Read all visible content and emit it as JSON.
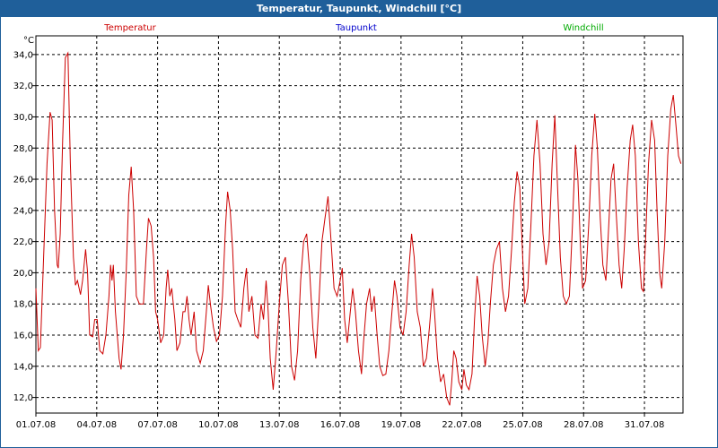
{
  "window": {
    "title": "Temperatur, Taupunkt, Windchill [°C]"
  },
  "chart_data": {
    "type": "line",
    "title": "Temperatur, Taupunkt, Windchill [°C]",
    "ylabel": "°C",
    "xlabel": "",
    "x_range_days": [
      1,
      32.9
    ],
    "ylim": [
      11,
      35.2
    ],
    "yticks": [
      12.0,
      14.0,
      16.0,
      18.0,
      20.0,
      22.0,
      24.0,
      26.0,
      28.0,
      30.0,
      32.0,
      34.0
    ],
    "ytick_labels": [
      "12,0",
      "14,0",
      "16,0",
      "18,0",
      "20,0",
      "22,0",
      "24,0",
      "26,0",
      "28,0",
      "30,0",
      "32,0",
      "34,0"
    ],
    "xticks": [
      1,
      4,
      7,
      10,
      13,
      16,
      19,
      22,
      25,
      28,
      31
    ],
    "xtick_labels": [
      "01.07.08",
      "04.07.08",
      "07.07.08",
      "10.07.08",
      "13.07.08",
      "16.07.08",
      "19.07.08",
      "22.07.08",
      "25.07.08",
      "28.07.08",
      "31.07.08"
    ],
    "grid": true,
    "legend": [
      {
        "name": "Temperatur",
        "color": "#cc0000"
      },
      {
        "name": "Taupunkt",
        "color": "#0000cc"
      },
      {
        "name": "Windchill",
        "color": "#00aa00"
      }
    ],
    "series": [
      {
        "name": "Temperatur",
        "color": "#cc0000",
        "points": [
          [
            1.0,
            19.0
          ],
          [
            1.12,
            15.0
          ],
          [
            1.22,
            15.2
          ],
          [
            1.38,
            21.0
          ],
          [
            1.55,
            27.0
          ],
          [
            1.7,
            30.3
          ],
          [
            1.8,
            29.8
          ],
          [
            1.92,
            24.0
          ],
          [
            2.05,
            20.5
          ],
          [
            2.1,
            20.3
          ],
          [
            2.2,
            22.5
          ],
          [
            2.32,
            28.5
          ],
          [
            2.45,
            33.8
          ],
          [
            2.58,
            34.1
          ],
          [
            2.7,
            27.0
          ],
          [
            2.85,
            21.0
          ],
          [
            2.95,
            19.2
          ],
          [
            3.05,
            19.5
          ],
          [
            3.2,
            18.6
          ],
          [
            3.3,
            19.5
          ],
          [
            3.45,
            21.5
          ],
          [
            3.55,
            20.0
          ],
          [
            3.65,
            16.0
          ],
          [
            3.8,
            15.9
          ],
          [
            3.9,
            17.0
          ],
          [
            4.02,
            17.0
          ],
          [
            4.15,
            15.0
          ],
          [
            4.3,
            14.8
          ],
          [
            4.45,
            16.0
          ],
          [
            4.6,
            18.5
          ],
          [
            4.68,
            20.5
          ],
          [
            4.75,
            19.5
          ],
          [
            4.82,
            20.5
          ],
          [
            4.92,
            17.5
          ],
          [
            5.1,
            14.5
          ],
          [
            5.2,
            13.8
          ],
          [
            5.32,
            16.0
          ],
          [
            5.45,
            20.0
          ],
          [
            5.58,
            25.0
          ],
          [
            5.7,
            26.8
          ],
          [
            5.82,
            24.0
          ],
          [
            5.95,
            18.5
          ],
          [
            6.1,
            18.0
          ],
          [
            6.3,
            18.0
          ],
          [
            6.45,
            21.5
          ],
          [
            6.55,
            23.5
          ],
          [
            6.68,
            23.0
          ],
          [
            6.8,
            21.0
          ],
          [
            6.9,
            17.5
          ],
          [
            7.0,
            17.0
          ],
          [
            7.15,
            15.5
          ],
          [
            7.3,
            16.0
          ],
          [
            7.42,
            19.0
          ],
          [
            7.5,
            20.2
          ],
          [
            7.6,
            18.5
          ],
          [
            7.7,
            19.0
          ],
          [
            7.85,
            17.0
          ],
          [
            7.95,
            15.0
          ],
          [
            8.1,
            15.5
          ],
          [
            8.25,
            17.5
          ],
          [
            8.35,
            17.5
          ],
          [
            8.45,
            18.5
          ],
          [
            8.55,
            17.0
          ],
          [
            8.65,
            16.0
          ],
          [
            8.8,
            17.5
          ],
          [
            8.92,
            15.0
          ],
          [
            9.1,
            14.2
          ],
          [
            9.25,
            15.0
          ],
          [
            9.4,
            17.5
          ],
          [
            9.5,
            19.2
          ],
          [
            9.6,
            18.0
          ],
          [
            9.75,
            16.5
          ],
          [
            9.9,
            15.6
          ],
          [
            10.05,
            16.0
          ],
          [
            10.2,
            18.5
          ],
          [
            10.35,
            23.0
          ],
          [
            10.45,
            25.2
          ],
          [
            10.58,
            24.0
          ],
          [
            10.7,
            21.5
          ],
          [
            10.82,
            17.5
          ],
          [
            10.95,
            17.0
          ],
          [
            11.1,
            16.5
          ],
          [
            11.25,
            19.0
          ],
          [
            11.38,
            20.3
          ],
          [
            11.5,
            17.5
          ],
          [
            11.65,
            18.5
          ],
          [
            11.8,
            16.0
          ],
          [
            11.95,
            15.8
          ],
          [
            12.1,
            18.0
          ],
          [
            12.22,
            17.0
          ],
          [
            12.35,
            19.5
          ],
          [
            12.45,
            17.5
          ],
          [
            12.55,
            14.5
          ],
          [
            12.7,
            12.5
          ],
          [
            12.85,
            15.0
          ],
          [
            13.0,
            18.0
          ],
          [
            13.15,
            20.5
          ],
          [
            13.3,
            21.0
          ],
          [
            13.45,
            18.0
          ],
          [
            13.6,
            14.0
          ],
          [
            13.75,
            13.1
          ],
          [
            13.9,
            15.0
          ],
          [
            14.05,
            19.5
          ],
          [
            14.2,
            22.0
          ],
          [
            14.35,
            22.5
          ],
          [
            14.5,
            20.0
          ],
          [
            14.65,
            16.5
          ],
          [
            14.8,
            14.5
          ],
          [
            14.95,
            18.0
          ],
          [
            15.1,
            22.0
          ],
          [
            15.25,
            23.5
          ],
          [
            15.4,
            24.9
          ],
          [
            15.55,
            22.0
          ],
          [
            15.7,
            19.0
          ],
          [
            15.85,
            18.5
          ],
          [
            16.0,
            19.5
          ],
          [
            16.1,
            20.3
          ],
          [
            16.22,
            17.0
          ],
          [
            16.35,
            15.5
          ],
          [
            16.5,
            17.5
          ],
          [
            16.62,
            19.0
          ],
          [
            16.75,
            17.5
          ],
          [
            16.9,
            15.0
          ],
          [
            17.05,
            13.5
          ],
          [
            17.15,
            15.5
          ],
          [
            17.3,
            18.0
          ],
          [
            17.45,
            19.0
          ],
          [
            17.55,
            17.5
          ],
          [
            17.68,
            18.5
          ],
          [
            17.82,
            16.0
          ],
          [
            17.95,
            14.0
          ],
          [
            18.1,
            13.4
          ],
          [
            18.25,
            13.5
          ],
          [
            18.4,
            15.0
          ],
          [
            18.55,
            17.5
          ],
          [
            18.68,
            19.5
          ],
          [
            18.8,
            18.5
          ],
          [
            18.95,
            16.5
          ],
          [
            19.1,
            16.0
          ],
          [
            19.25,
            17.5
          ],
          [
            19.4,
            20.5
          ],
          [
            19.52,
            22.5
          ],
          [
            19.65,
            21.0
          ],
          [
            19.8,
            17.5
          ],
          [
            19.95,
            16.5
          ],
          [
            20.1,
            14.0
          ],
          [
            20.25,
            14.5
          ],
          [
            20.4,
            16.5
          ],
          [
            20.55,
            19.0
          ],
          [
            20.65,
            17.5
          ],
          [
            20.8,
            14.5
          ],
          [
            20.95,
            13.0
          ],
          [
            21.1,
            13.5
          ],
          [
            21.25,
            12.0
          ],
          [
            21.4,
            11.5
          ],
          [
            21.5,
            13.0
          ],
          [
            21.6,
            15.0
          ],
          [
            21.72,
            14.5
          ],
          [
            21.85,
            13.0
          ],
          [
            22.0,
            12.5
          ],
          [
            22.1,
            13.8
          ],
          [
            22.22,
            12.8
          ],
          [
            22.35,
            12.5
          ],
          [
            22.5,
            13.5
          ],
          [
            22.62,
            17.0
          ],
          [
            22.75,
            19.8
          ],
          [
            22.88,
            18.5
          ],
          [
            23.0,
            16.0
          ],
          [
            23.15,
            14.0
          ],
          [
            23.28,
            15.5
          ],
          [
            23.4,
            18.0
          ],
          [
            23.55,
            20.5
          ],
          [
            23.7,
            21.5
          ],
          [
            23.85,
            22.0
          ],
          [
            24.0,
            19.0
          ],
          [
            24.15,
            17.5
          ],
          [
            24.3,
            18.5
          ],
          [
            24.45,
            21.5
          ],
          [
            24.58,
            24.5
          ],
          [
            24.72,
            26.5
          ],
          [
            24.85,
            25.5
          ],
          [
            25.0,
            21.0
          ],
          [
            25.1,
            18.0
          ],
          [
            25.25,
            19.0
          ],
          [
            25.4,
            23.0
          ],
          [
            25.55,
            27.5
          ],
          [
            25.7,
            29.8
          ],
          [
            25.85,
            27.0
          ],
          [
            26.0,
            22.5
          ],
          [
            26.15,
            20.5
          ],
          [
            26.3,
            22.0
          ],
          [
            26.45,
            27.0
          ],
          [
            26.58,
            30.1
          ],
          [
            26.7,
            26.0
          ],
          [
            26.85,
            21.0
          ],
          [
            27.0,
            18.5
          ],
          [
            27.15,
            18.0
          ],
          [
            27.3,
            18.5
          ],
          [
            27.45,
            23.0
          ],
          [
            27.6,
            28.2
          ],
          [
            27.72,
            26.0
          ],
          [
            27.85,
            21.5
          ],
          [
            27.95,
            19.0
          ],
          [
            28.1,
            19.5
          ],
          [
            28.25,
            23.0
          ],
          [
            28.4,
            27.5
          ],
          [
            28.55,
            30.2
          ],
          [
            28.68,
            28.0
          ],
          [
            28.82,
            23.5
          ],
          [
            28.95,
            20.5
          ],
          [
            29.1,
            19.5
          ],
          [
            29.22,
            22.5
          ],
          [
            29.35,
            26.0
          ],
          [
            29.48,
            27.0
          ],
          [
            29.6,
            24.0
          ],
          [
            29.75,
            20.5
          ],
          [
            29.88,
            19.0
          ],
          [
            30.0,
            21.5
          ],
          [
            30.15,
            25.5
          ],
          [
            30.3,
            28.5
          ],
          [
            30.42,
            29.5
          ],
          [
            30.55,
            27.5
          ],
          [
            30.7,
            22.0
          ],
          [
            30.85,
            19.0
          ],
          [
            30.95,
            18.8
          ],
          [
            31.05,
            22.0
          ],
          [
            31.2,
            27.0
          ],
          [
            31.35,
            29.8
          ],
          [
            31.5,
            28.5
          ],
          [
            31.62,
            24.0
          ],
          [
            31.75,
            20.0
          ],
          [
            31.85,
            19.0
          ],
          [
            32.0,
            22.0
          ],
          [
            32.15,
            27.5
          ],
          [
            32.3,
            30.5
          ],
          [
            32.42,
            31.4
          ],
          [
            32.55,
            29.5
          ],
          [
            32.68,
            27.5
          ],
          [
            32.8,
            27.0
          ]
        ]
      }
    ]
  }
}
